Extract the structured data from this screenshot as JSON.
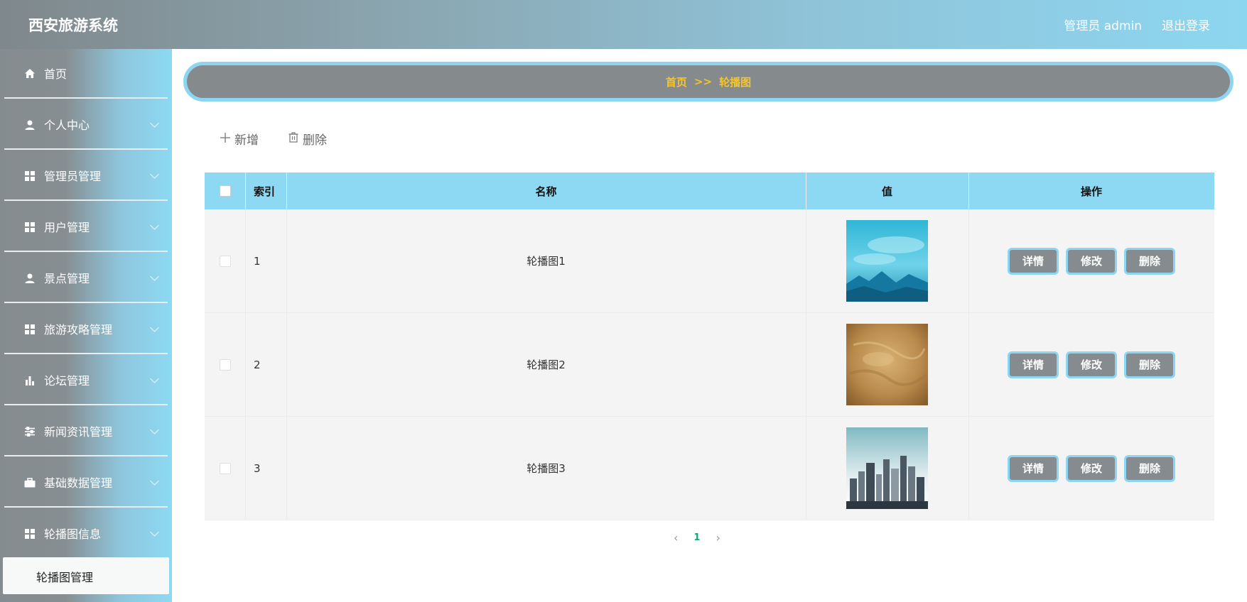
{
  "header": {
    "title": "西安旅游系统",
    "user_label": "管理员 admin",
    "logout_label": "退出登录"
  },
  "sidebar": {
    "items": [
      {
        "label": "首页",
        "icon": "home-icon"
      },
      {
        "label": "个人中心",
        "icon": "user-icon"
      },
      {
        "label": "管理员管理",
        "icon": "grid-icon"
      },
      {
        "label": "用户管理",
        "icon": "grid-icon"
      },
      {
        "label": "景点管理",
        "icon": "user-icon"
      },
      {
        "label": "旅游攻略管理",
        "icon": "grid-icon"
      },
      {
        "label": "论坛管理",
        "icon": "bar-chart-icon"
      },
      {
        "label": "新闻资讯管理",
        "icon": "sliders-icon"
      },
      {
        "label": "基础数据管理",
        "icon": "briefcase-icon"
      },
      {
        "label": "轮播图信息",
        "icon": "grid-icon"
      }
    ],
    "sub_item": "轮播图管理"
  },
  "breadcrumb": {
    "home": "首页",
    "separator": ">>",
    "current": "轮播图"
  },
  "toolbar": {
    "add_label": "新增",
    "delete_label": "删除"
  },
  "table": {
    "columns": [
      "索引",
      "名称",
      "值",
      "操作"
    ],
    "rows": [
      {
        "index": "1",
        "name": "轮播图1",
        "image": "sky-mountain"
      },
      {
        "index": "2",
        "name": "轮播图2",
        "image": "parchment"
      },
      {
        "index": "3",
        "name": "轮播图3",
        "image": "city-skyline"
      }
    ],
    "actions": [
      "详情",
      "修改",
      "删除"
    ]
  },
  "pagination": {
    "current_page": "1"
  },
  "colors": {
    "accent": "#8dd9f3",
    "button": "#858b8e",
    "breadcrumb_text": "#f7c42b",
    "pager_active": "#1aa67a"
  }
}
